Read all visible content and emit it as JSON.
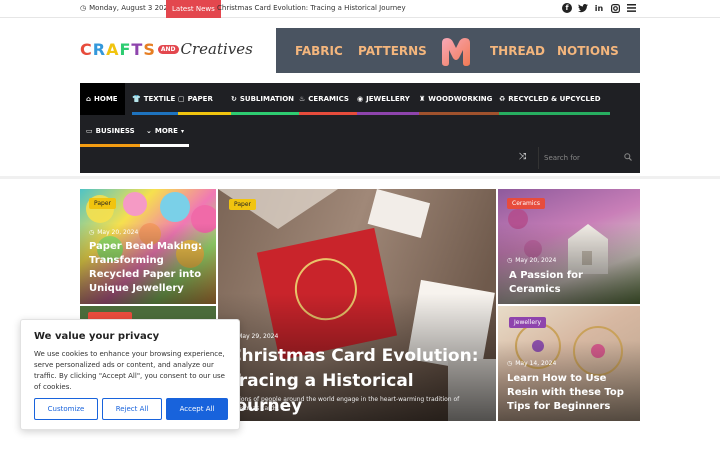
{
  "topbar": {
    "date": "Monday, August 3 2026",
    "latest_label": "Latest News",
    "headline": "Christmas Card Evolution: Tracing a Historical Journey",
    "social": [
      "facebook-icon",
      "twitter-icon",
      "linkedin-icon",
      "instagram-icon",
      "menu-icon"
    ]
  },
  "logo": {
    "crafts": "CRAFTS",
    "and": "AND",
    "creatives": "Creatives"
  },
  "banner": {
    "words": [
      "FABRIC",
      "PATTERNS",
      "THREAD",
      "NOTIONS"
    ],
    "accent": "#f4b67d",
    "bg": "#4a5461"
  },
  "nav": {
    "items": [
      {
        "label": "HOME",
        "icon": "home-icon",
        "color": "#000000"
      },
      {
        "label": "TEXTILE",
        "icon": "shirt-icon",
        "color": "#1e73be"
      },
      {
        "label": "PAPER",
        "icon": "paper-icon",
        "color": "#f1c40f"
      },
      {
        "label": "SUBLIMATION",
        "icon": "sublimation-icon",
        "color": "#2ecc71"
      },
      {
        "label": "CERAMICS",
        "icon": "flame-icon",
        "color": "#e74c3c"
      },
      {
        "label": "JEWELLERY",
        "icon": "ring-icon",
        "color": "#8e44ad"
      },
      {
        "label": "WOODWORKING",
        "icon": "woodworking-icon",
        "color": "#a0522d"
      },
      {
        "label": "RECYCLED & UPCYCLED",
        "icon": "recycle-icon",
        "color": "#27ae60"
      },
      {
        "label": "BUSINESS",
        "icon": "laptop-icon",
        "color": "#f39c12"
      },
      {
        "label": "MORE",
        "icon": "chevron-down-icon",
        "color": "#ffffff"
      }
    ],
    "search_placeholder": "Search for"
  },
  "cards": [
    {
      "category": "Paper",
      "date": "May 20, 2024",
      "title": "Paper Bead Making: Transforming Recycled Paper into Unique Jewellery",
      "badge_color": "#f1c40f"
    },
    {
      "category": "Paper",
      "date": "May 29, 2024",
      "title": "Christmas Card Evolution: Tracing a Historical Journey",
      "excerpt": "Millions of people around the world engage in the heart-warming tradition of Christmas cards.",
      "badge_color": "#f1c40f"
    },
    {
      "category": "Ceramics",
      "date": "May 20, 2024",
      "title": "A Passion for Ceramics",
      "badge_color": "#e74c3c"
    },
    {
      "category": "Jewellery",
      "date": "May 14, 2024",
      "title": "Learn How to Use Resin with these Top Tips for Beginners",
      "badge_color": "#8e44ad"
    }
  ],
  "cookie": {
    "title": "We value your privacy",
    "body": "We use cookies to enhance your browsing experience, serve personalized ads or content, and analyze our traffic. By clicking \"Accept All\", you consent to our use of cookies.",
    "customize": "Customize",
    "reject": "Reject All",
    "accept": "Accept All"
  }
}
